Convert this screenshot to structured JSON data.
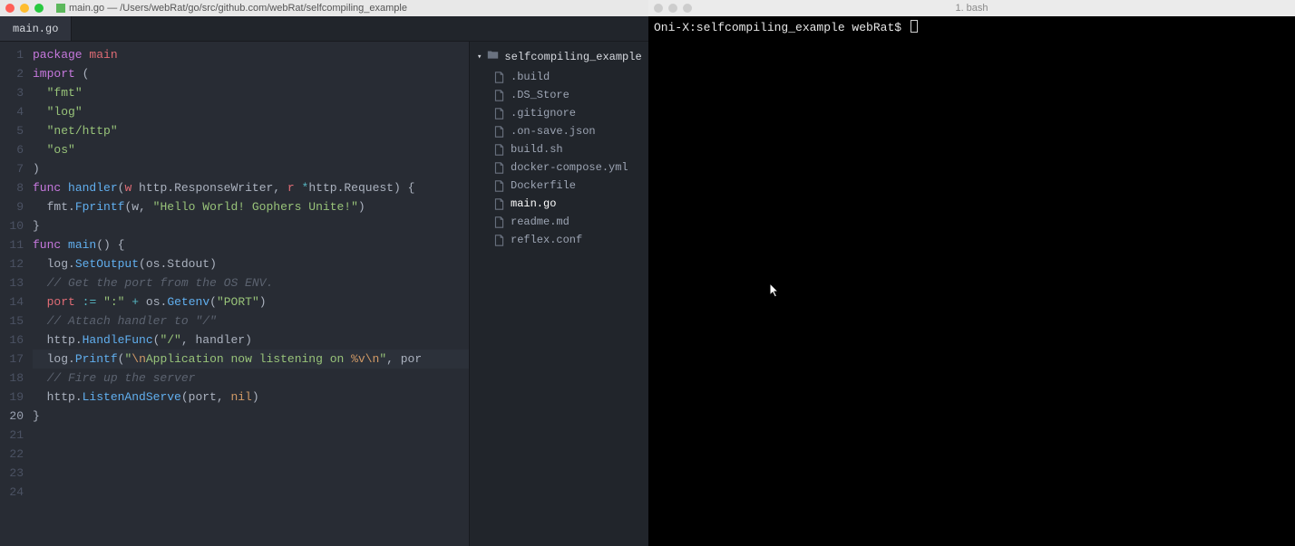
{
  "editor": {
    "titlebar": {
      "title": "main.go — /Users/webRat/go/src/github.com/webRat/selfcompiling_example"
    },
    "tabs": [
      {
        "label": "main.go",
        "active": true
      }
    ],
    "lines": {
      "1": [
        {
          "t": "package ",
          "c": "kw"
        },
        {
          "t": "main",
          "c": "id"
        }
      ],
      "2": [
        {
          "t": "",
          "c": ""
        }
      ],
      "3": [
        {
          "t": "import ",
          "c": "kw"
        },
        {
          "t": "(",
          "c": ""
        }
      ],
      "4": [
        {
          "t": "  ",
          "c": ""
        },
        {
          "t": "\"fmt\"",
          "c": "str"
        }
      ],
      "5": [
        {
          "t": "  ",
          "c": ""
        },
        {
          "t": "\"log\"",
          "c": "str"
        }
      ],
      "6": [
        {
          "t": "  ",
          "c": ""
        },
        {
          "t": "\"net/http\"",
          "c": "str"
        }
      ],
      "7": [
        {
          "t": "  ",
          "c": ""
        },
        {
          "t": "\"os\"",
          "c": "str"
        }
      ],
      "8": [
        {
          "t": ")",
          "c": ""
        }
      ],
      "9": [
        {
          "t": "",
          "c": ""
        }
      ],
      "10": [
        {
          "t": "func ",
          "c": "kw"
        },
        {
          "t": "handler",
          "c": "fn"
        },
        {
          "t": "(",
          "c": ""
        },
        {
          "t": "w",
          "c": "id"
        },
        {
          "t": " http",
          "c": ""
        },
        {
          "t": ".",
          "c": ""
        },
        {
          "t": "ResponseWriter",
          "c": ""
        },
        {
          "t": ", ",
          "c": ""
        },
        {
          "t": "r",
          "c": "id"
        },
        {
          "t": " ",
          "c": ""
        },
        {
          "t": "*",
          "c": "op"
        },
        {
          "t": "http",
          "c": ""
        },
        {
          "t": ".",
          "c": ""
        },
        {
          "t": "Request",
          "c": ""
        },
        {
          "t": ") {",
          "c": ""
        }
      ],
      "11": [
        {
          "t": "  fmt",
          "c": ""
        },
        {
          "t": ".",
          "c": ""
        },
        {
          "t": "Fprintf",
          "c": "fn"
        },
        {
          "t": "(w, ",
          "c": ""
        },
        {
          "t": "\"Hello World! Gophers Unite!\"",
          "c": "str"
        },
        {
          "t": ")",
          "c": ""
        }
      ],
      "12": [
        {
          "t": "}",
          "c": ""
        }
      ],
      "13": [
        {
          "t": "",
          "c": ""
        }
      ],
      "14": [
        {
          "t": "func ",
          "c": "kw"
        },
        {
          "t": "main",
          "c": "fn"
        },
        {
          "t": "() {",
          "c": ""
        }
      ],
      "15": [
        {
          "t": "  log",
          "c": ""
        },
        {
          "t": ".",
          "c": ""
        },
        {
          "t": "SetOutput",
          "c": "fn"
        },
        {
          "t": "(os",
          "c": ""
        },
        {
          "t": ".",
          "c": ""
        },
        {
          "t": "Stdout",
          "c": ""
        },
        {
          "t": ")",
          "c": ""
        }
      ],
      "16": [
        {
          "t": "  ",
          "c": ""
        },
        {
          "t": "// Get the port from the OS ENV.",
          "c": "cm"
        }
      ],
      "17": [
        {
          "t": "  ",
          "c": ""
        },
        {
          "t": "port",
          "c": "id"
        },
        {
          "t": " ",
          "c": ""
        },
        {
          "t": ":=",
          "c": "op"
        },
        {
          "t": " ",
          "c": ""
        },
        {
          "t": "\":\"",
          "c": "str"
        },
        {
          "t": " ",
          "c": ""
        },
        {
          "t": "+",
          "c": "op"
        },
        {
          "t": " os",
          "c": ""
        },
        {
          "t": ".",
          "c": ""
        },
        {
          "t": "Getenv",
          "c": "fn"
        },
        {
          "t": "(",
          "c": ""
        },
        {
          "t": "\"PORT\"",
          "c": "str"
        },
        {
          "t": ")",
          "c": ""
        }
      ],
      "18": [
        {
          "t": "  ",
          "c": ""
        },
        {
          "t": "// Attach handler to \"/\"",
          "c": "cm"
        }
      ],
      "19": [
        {
          "t": "  http",
          "c": ""
        },
        {
          "t": ".",
          "c": ""
        },
        {
          "t": "HandleFunc",
          "c": "fn"
        },
        {
          "t": "(",
          "c": ""
        },
        {
          "t": "\"/\"",
          "c": "str"
        },
        {
          "t": ", handler)",
          "c": ""
        }
      ],
      "20": [
        {
          "t": "  log",
          "c": ""
        },
        {
          "t": ".",
          "c": ""
        },
        {
          "t": "Printf",
          "c": "fn"
        },
        {
          "t": "(",
          "c": ""
        },
        {
          "t": "\"",
          "c": "str"
        },
        {
          "t": "\\n",
          "c": "cst"
        },
        {
          "t": "Application now listening on ",
          "c": "str"
        },
        {
          "t": "%v",
          "c": "cst"
        },
        {
          "t": "\\n",
          "c": "cst"
        },
        {
          "t": "\"",
          "c": "str"
        },
        {
          "t": ", por",
          "c": ""
        }
      ],
      "21": [
        {
          "t": "  ",
          "c": ""
        },
        {
          "t": "// Fire up the server",
          "c": "cm"
        }
      ],
      "22": [
        {
          "t": "  http",
          "c": ""
        },
        {
          "t": ".",
          "c": ""
        },
        {
          "t": "ListenAndServe",
          "c": "fn"
        },
        {
          "t": "(port, ",
          "c": ""
        },
        {
          "t": "nil",
          "c": "cst"
        },
        {
          "t": ")",
          "c": ""
        }
      ],
      "23": [
        {
          "t": "}",
          "c": ""
        }
      ],
      "24": [
        {
          "t": "",
          "c": ""
        }
      ]
    },
    "current_line": 20,
    "tree": {
      "root": "selfcompiling_example",
      "files": [
        {
          "name": ".build",
          "active": false
        },
        {
          "name": ".DS_Store",
          "active": false
        },
        {
          "name": ".gitignore",
          "active": false
        },
        {
          "name": ".on-save.json",
          "active": false
        },
        {
          "name": "build.sh",
          "active": false
        },
        {
          "name": "docker-compose.yml",
          "active": false
        },
        {
          "name": "Dockerfile",
          "active": false
        },
        {
          "name": "main.go",
          "active": true
        },
        {
          "name": "readme.md",
          "active": false
        },
        {
          "name": "reflex.conf",
          "active": false
        }
      ]
    }
  },
  "terminal": {
    "titlebar": {
      "title": "1. bash"
    },
    "prompt": "Oni-X:selfcompiling_example webRat$ "
  }
}
